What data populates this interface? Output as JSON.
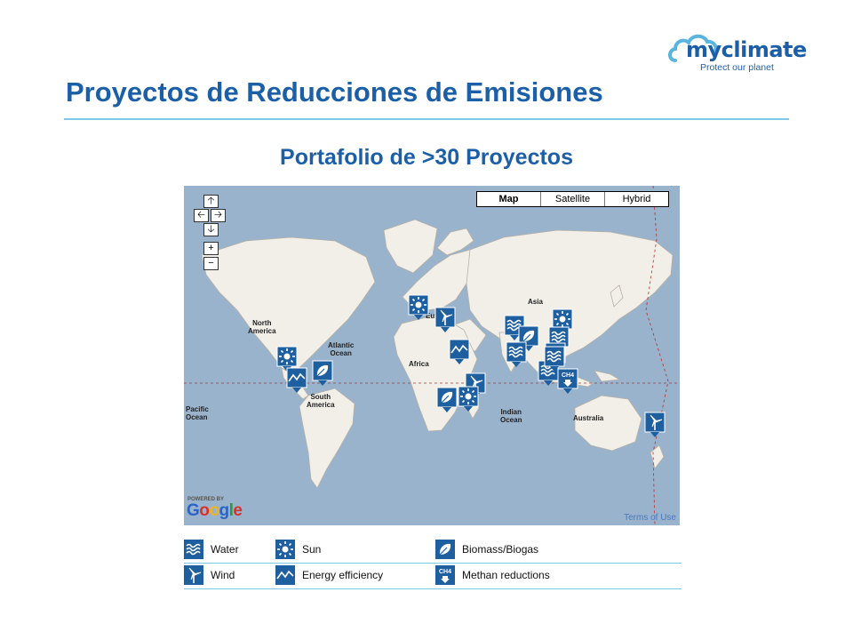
{
  "logo": {
    "name": "myclimate",
    "tagline": "Protect our planet"
  },
  "title": "Proyectos de Reducciones de Emisiones",
  "subtitle": "Portafolio de >30 Proyectos",
  "map": {
    "map_types": [
      "Map",
      "Satellite",
      "Hybrid"
    ],
    "selected_type": "Map",
    "nav_controls": {
      "up": "🡡",
      "left": "🡠",
      "right": "🡢",
      "down": "🡣",
      "zoom_in": "+",
      "zoom_out": "−"
    },
    "labels": {
      "asia": "Asia",
      "north_america": "North\nAmerica",
      "atlantic_ocean": "Atlantic\nOcean",
      "africa": "Africa",
      "south_america": "South\nAmerica",
      "pacific_ocean": "Pacific\nOcean",
      "indian_ocean": "Indian\nOcean",
      "australia": "Australia",
      "europe_partial": "Eu"
    },
    "powered_by": "POWERED BY",
    "google_letters": [
      "G",
      "o",
      "o",
      "g",
      "l",
      "e"
    ],
    "terms": "Terms of Use",
    "markers": [
      {
        "type": "sun",
        "region": "Europe"
      },
      {
        "type": "wind",
        "region": "Turkey"
      },
      {
        "type": "energy",
        "region": "Middle East"
      },
      {
        "type": "sun",
        "region": "Central America"
      },
      {
        "type": "energy",
        "region": "Central America"
      },
      {
        "type": "biomass",
        "region": "South America"
      },
      {
        "type": "water",
        "region": "India"
      },
      {
        "type": "biomass",
        "region": "India"
      },
      {
        "type": "sun",
        "region": "China"
      },
      {
        "type": "water",
        "region": "China"
      },
      {
        "type": "water",
        "region": "India"
      },
      {
        "type": "energy",
        "region": "India"
      },
      {
        "type": "water",
        "region": "Southeast Asia"
      },
      {
        "type": "water",
        "region": "Southeast Asia"
      },
      {
        "type": "methane",
        "region": "Indonesia"
      },
      {
        "type": "wind",
        "region": "Madagascar"
      },
      {
        "type": "biomass",
        "region": "Southern Africa"
      },
      {
        "type": "sun",
        "region": "Southern Africa"
      },
      {
        "type": "wind",
        "region": "New Zealand"
      }
    ]
  },
  "legend": [
    {
      "icon": "water-icon",
      "label": "Water"
    },
    {
      "icon": "sun-icon",
      "label": "Sun"
    },
    {
      "icon": "biomass-icon",
      "label": "Biomass/Biogas"
    },
    {
      "icon": "wind-icon",
      "label": "Wind"
    },
    {
      "icon": "energy-efficiency-icon",
      "label": "Energy efficiency"
    },
    {
      "icon": "methane-icon",
      "label": "Methan reductions"
    }
  ],
  "colors": {
    "brand": "#1b5fa8",
    "marker": "#1e5f9f",
    "ocean": "#99b3cc",
    "land": "#f2efe9",
    "rule": "#7fc8e6"
  }
}
